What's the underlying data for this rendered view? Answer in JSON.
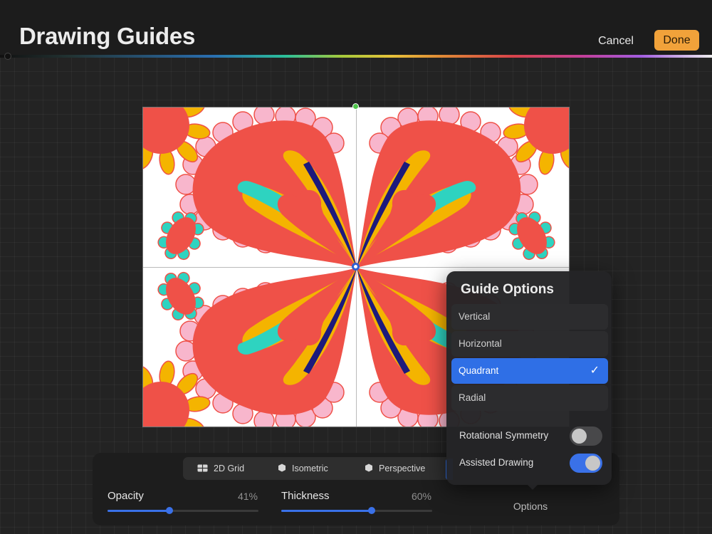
{
  "header": {
    "title": "Drawing Guides",
    "cancel_label": "Cancel",
    "done_label": "Done",
    "done_color": "#f1a23a"
  },
  "guide_types": {
    "tabs": [
      {
        "label": "2D Grid",
        "icon": "grid-icon"
      },
      {
        "label": "Isometric",
        "icon": "cube-icon"
      },
      {
        "label": "Perspective",
        "icon": "cube-icon"
      }
    ]
  },
  "sliders": {
    "opacity": {
      "label": "Opacity",
      "value_text": "41%",
      "value": 0.41
    },
    "thickness": {
      "label": "Thickness",
      "value_text": "60%",
      "value": 0.6
    }
  },
  "options_label": "Options",
  "guide_options": {
    "title": "Guide Options",
    "modes": [
      {
        "label": "Vertical",
        "selected": false
      },
      {
        "label": "Horizontal",
        "selected": false
      },
      {
        "label": "Quadrant",
        "selected": true
      },
      {
        "label": "Radial",
        "selected": false
      }
    ],
    "check_glyph": "✓",
    "toggles": [
      {
        "label": "Rotational Symmetry",
        "on": false
      },
      {
        "label": "Assisted Drawing",
        "on": true
      }
    ]
  },
  "colors": {
    "accent": "#2f6fe6",
    "artwork_red": "#ef5148",
    "artwork_yellow": "#f4b400",
    "artwork_teal": "#2ed3c0",
    "artwork_navy": "#1d1a7c",
    "artwork_pink": "#f8b6cc"
  }
}
